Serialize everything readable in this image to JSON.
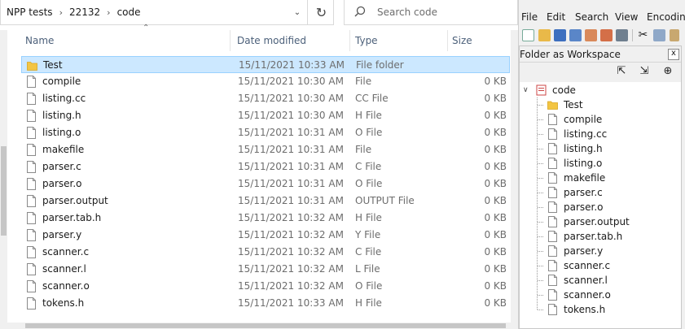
{
  "explorer": {
    "breadcrumb": [
      "NPP tests",
      "22132",
      "code"
    ],
    "search_placeholder": "Search code",
    "columns": {
      "name": "Name",
      "date": "Date modified",
      "type": "Type",
      "size": "Size"
    },
    "files": [
      {
        "name": "Test",
        "date": "15/11/2021 10:33 AM",
        "type": "File folder",
        "size": "",
        "icon": "folder-icon",
        "selected": true
      },
      {
        "name": "compile",
        "date": "15/11/2021 10:30 AM",
        "type": "File",
        "size": "0 KB",
        "icon": "file-icon"
      },
      {
        "name": "listing.cc",
        "date": "15/11/2021 10:30 AM",
        "type": "CC File",
        "size": "0 KB",
        "icon": "file-icon"
      },
      {
        "name": "listing.h",
        "date": "15/11/2021 10:30 AM",
        "type": "H File",
        "size": "0 KB",
        "icon": "file-icon"
      },
      {
        "name": "listing.o",
        "date": "15/11/2021 10:31 AM",
        "type": "O File",
        "size": "0 KB",
        "icon": "file-icon"
      },
      {
        "name": "makefile",
        "date": "15/11/2021 10:31 AM",
        "type": "File",
        "size": "0 KB",
        "icon": "file-icon"
      },
      {
        "name": "parser.c",
        "date": "15/11/2021 10:31 AM",
        "type": "C File",
        "size": "0 KB",
        "icon": "file-icon"
      },
      {
        "name": "parser.o",
        "date": "15/11/2021 10:31 AM",
        "type": "O File",
        "size": "0 KB",
        "icon": "file-icon"
      },
      {
        "name": "parser.output",
        "date": "15/11/2021 10:31 AM",
        "type": "OUTPUT File",
        "size": "0 KB",
        "icon": "file-icon"
      },
      {
        "name": "parser.tab.h",
        "date": "15/11/2021 10:32 AM",
        "type": "H File",
        "size": "0 KB",
        "icon": "file-icon"
      },
      {
        "name": "parser.y",
        "date": "15/11/2021 10:32 AM",
        "type": "Y File",
        "size": "0 KB",
        "icon": "file-icon"
      },
      {
        "name": "scanner.c",
        "date": "15/11/2021 10:32 AM",
        "type": "C File",
        "size": "0 KB",
        "icon": "file-icon"
      },
      {
        "name": "scanner.l",
        "date": "15/11/2021 10:32 AM",
        "type": "L File",
        "size": "0 KB",
        "icon": "file-icon"
      },
      {
        "name": "scanner.o",
        "date": "15/11/2021 10:32 AM",
        "type": "O File",
        "size": "0 KB",
        "icon": "file-icon"
      },
      {
        "name": "tokens.h",
        "date": "15/11/2021 10:33 AM",
        "type": "H File",
        "size": "0 KB",
        "icon": "file-icon"
      }
    ]
  },
  "npp": {
    "menu": [
      "File",
      "Edit",
      "Search",
      "View",
      "Encoding"
    ],
    "panel_title": "Folder as Workspace",
    "close_label": "x",
    "panel_buttons": [
      "collapse-all-icon",
      "expand-all-icon",
      "locate-current-file-icon"
    ],
    "tree_root": "code",
    "tree_items": [
      {
        "label": "Test",
        "icon": "folder-icon"
      },
      {
        "label": "compile",
        "icon": "file-icon"
      },
      {
        "label": "listing.cc",
        "icon": "file-icon"
      },
      {
        "label": "listing.h",
        "icon": "file-icon"
      },
      {
        "label": "listing.o",
        "icon": "file-icon"
      },
      {
        "label": "makefile",
        "icon": "file-icon"
      },
      {
        "label": "parser.c",
        "icon": "file-icon"
      },
      {
        "label": "parser.o",
        "icon": "file-icon"
      },
      {
        "label": "parser.output",
        "icon": "file-icon"
      },
      {
        "label": "parser.tab.h",
        "icon": "file-icon"
      },
      {
        "label": "parser.y",
        "icon": "file-icon"
      },
      {
        "label": "scanner.c",
        "icon": "file-icon"
      },
      {
        "label": "scanner.l",
        "icon": "file-icon"
      },
      {
        "label": "scanner.o",
        "icon": "file-icon"
      },
      {
        "label": "tokens.h",
        "icon": "file-icon"
      }
    ]
  },
  "colors": {
    "selection": "#cce8ff",
    "selection_border": "#99d1ff",
    "folder": "#f3c543",
    "header_text": "#4c607a"
  }
}
